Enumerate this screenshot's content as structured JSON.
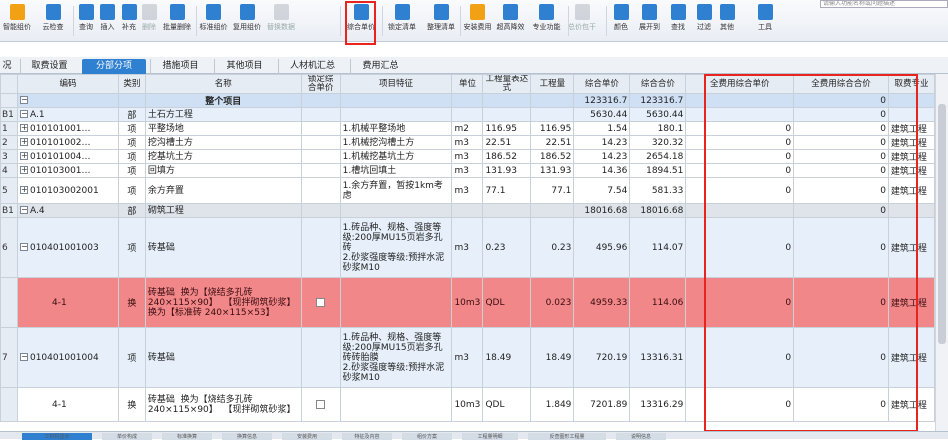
{
  "toolbar": {
    "search_placeholder": "请输入功能名称或问题描述",
    "buttons": [
      {
        "label": "智能组价",
        "icon": "smart-price-icon",
        "color": "#f2a114"
      },
      {
        "label": "云检查",
        "icon": "cloud-check-icon",
        "color": "#2f80d0"
      },
      {
        "label": "查询",
        "icon": "query-icon",
        "color": "#2f80d0"
      },
      {
        "label": "插入",
        "icon": "insert-icon",
        "color": "#2f80d0"
      },
      {
        "label": "补充",
        "icon": "supplement-icon",
        "color": "#2f80d0"
      },
      {
        "label": "删除",
        "icon": "delete-icon",
        "color": "#9aa3ad",
        "disabled": true
      },
      {
        "label": "批量删除",
        "icon": "batch-delete-icon",
        "color": "#2f80d0"
      },
      {
        "label": "标准组价",
        "icon": "standard-price-icon",
        "color": "#2f80d0"
      },
      {
        "label": "复用组价",
        "icon": "reuse-price-icon",
        "color": "#2f80d0"
      },
      {
        "label": "替换数据",
        "icon": "replace-data-icon",
        "color": "#9aa3ad",
        "disabled": true
      },
      {
        "label": "综合单价",
        "icon": "unit-price-icon",
        "color": "#2f80d0"
      },
      {
        "label": "锁定清单",
        "icon": "lock-list-icon",
        "color": "#2f80d0"
      },
      {
        "label": "整理清单",
        "icon": "organize-list-icon",
        "color": "#2f80d0"
      },
      {
        "label": "安装费用",
        "icon": "install-fee-icon",
        "color": "#f2a114"
      },
      {
        "label": "超高降效",
        "icon": "height-reduce-icon",
        "color": "#2f80d0"
      },
      {
        "label": "专业功能",
        "icon": "specialty-icon",
        "color": "#2f80d0"
      },
      {
        "label": "总价包干",
        "icon": "lump-sum-icon",
        "color": "#9aa3ad",
        "disabled": true
      },
      {
        "label": "颜色",
        "icon": "color-icon",
        "color": "#2f80d0"
      },
      {
        "label": "展开到",
        "icon": "expand-icon",
        "color": "#2f80d0"
      },
      {
        "label": "查找",
        "icon": "find-icon",
        "color": "#2f80d0"
      },
      {
        "label": "过滤",
        "icon": "filter-icon",
        "color": "#2f80d0"
      },
      {
        "label": "其他",
        "icon": "other-icon",
        "color": "#2f80d0"
      },
      {
        "label": "工具",
        "icon": "tools-icon",
        "color": "#2f80d0"
      }
    ]
  },
  "tabs": {
    "left_stub": "况",
    "items": [
      "取费设置",
      "分部分项",
      "措施项目",
      "其他项目",
      "人材机汇总",
      "费用汇总"
    ],
    "active": 1
  },
  "table": {
    "headers": [
      "编码",
      "类别",
      "名称",
      "锁定综合单价",
      "项目特征",
      "单位",
      "工程量表达式",
      "工程量",
      "综合单价",
      "综合合价",
      "全费用综合单价",
      "全费用综合合价",
      "取费专业"
    ],
    "rows": [
      {
        "rh": "",
        "code": "",
        "cat": "",
        "name": "整个项目",
        "feature": "",
        "unit": "",
        "expr": "",
        "qty": "",
        "price": "123316.7",
        "total": "123316.7",
        "fprice": "",
        "ftotal": "0",
        "spec": ""
      },
      {
        "rh": "B1",
        "code": "A.1",
        "cat": "部",
        "name": "土石方工程",
        "feature": "",
        "unit": "",
        "expr": "",
        "qty": "",
        "price": "5630.44",
        "total": "5630.44",
        "fprice": "",
        "ftotal": "0",
        "spec": ""
      },
      {
        "rh": "1",
        "code": "010101001…",
        "cat": "项",
        "name": "平整场地",
        "feature": "1.机械平整场地",
        "unit": "m2",
        "expr": "116.95",
        "qty": "116.95",
        "price": "1.54",
        "total": "180.1",
        "fprice": "0",
        "ftotal": "0",
        "spec": "建筑工程"
      },
      {
        "rh": "2",
        "code": "010101002…",
        "cat": "项",
        "name": "挖沟槽土方",
        "feature": "1.机械挖沟槽土方",
        "unit": "m3",
        "expr": "22.51",
        "qty": "22.51",
        "price": "14.23",
        "total": "320.32",
        "fprice": "0",
        "ftotal": "0",
        "spec": "建筑工程"
      },
      {
        "rh": "3",
        "code": "010101004…",
        "cat": "项",
        "name": "挖基坑土方",
        "feature": "1.机械挖基坑土方",
        "unit": "m3",
        "expr": "186.52",
        "qty": "186.52",
        "price": "14.23",
        "total": "2654.18",
        "fprice": "0",
        "ftotal": "0",
        "spec": "建筑工程"
      },
      {
        "rh": "4",
        "code": "010103001…",
        "cat": "项",
        "name": "回填方",
        "feature": "1.槽坑回填土",
        "unit": "m3",
        "expr": "131.93",
        "qty": "131.93",
        "price": "14.36",
        "total": "1894.51",
        "fprice": "0",
        "ftotal": "0",
        "spec": "建筑工程"
      },
      {
        "rh": "5",
        "code": "010103002001",
        "cat": "项",
        "name": "余方弃置",
        "feature": "1.余方弃置，暂按1km考虑",
        "unit": "m3",
        "expr": "77.1",
        "qty": "77.1",
        "price": "7.54",
        "total": "581.33",
        "fprice": "0",
        "ftotal": "0",
        "spec": "建筑工程"
      },
      {
        "rh": "B1",
        "code": "A.4",
        "cat": "部",
        "name": "砌筑工程",
        "feature": "",
        "unit": "",
        "expr": "",
        "qty": "",
        "price": "18016.68",
        "total": "18016.68",
        "fprice": "",
        "ftotal": "0",
        "spec": ""
      },
      {
        "rh": "6",
        "code": "010401001003",
        "cat": "项",
        "name": "砖基础",
        "feature": "1.砖品种、规格、强度等级:200厚MU15页岩多孔砖\n2.砂浆强度等级:预拌水泥砂浆M10",
        "unit": "m3",
        "expr": "0.23",
        "qty": "0.23",
        "price": "495.96",
        "total": "114.07",
        "fprice": "0",
        "ftotal": "0",
        "spec": "建筑工程"
      },
      {
        "rh": "",
        "code": "4-1",
        "cat": "换",
        "name": "砖基础  换为【烧结多孔砖 240×115×90】  【现拌砌筑砂浆】 换为【标准砖 240×115×53】",
        "feature": "",
        "unit": "10m3",
        "expr": "QDL",
        "qty": "0.023",
        "price": "4959.33",
        "total": "114.06",
        "fprice": "0",
        "ftotal": "0",
        "spec": "建筑工程"
      },
      {
        "rh": "7",
        "code": "010401001004",
        "cat": "项",
        "name": "砖基础",
        "feature": "1.砖品种、规格、强度等级:200厚MU15页岩多孔砖砖胎膜\n2.砂浆强度等级:预拌水泥砂浆M10",
        "unit": "m3",
        "expr": "18.49",
        "qty": "18.49",
        "price": "720.19",
        "total": "13316.31",
        "fprice": "0",
        "ftotal": "0",
        "spec": "建筑工程"
      },
      {
        "rh": "",
        "code": "4-1",
        "cat": "换",
        "name": "砖基础  换为【烧结多孔砖 240×115×90】  【现拌砌筑砂浆】",
        "feature": "",
        "unit": "10m3",
        "expr": "QDL",
        "qty": "1.849",
        "price": "7201.89",
        "total": "13316.29",
        "fprice": "0",
        "ftotal": "0",
        "spec": "建筑工程"
      }
    ]
  },
  "bottom_tabs": [
    "工料机显示",
    "单价构成",
    "标准换算",
    "换算信息",
    "安装费用",
    "特征及内容",
    "组价方案",
    "工程量明细",
    "反查图形工程量",
    "说明信息"
  ]
}
